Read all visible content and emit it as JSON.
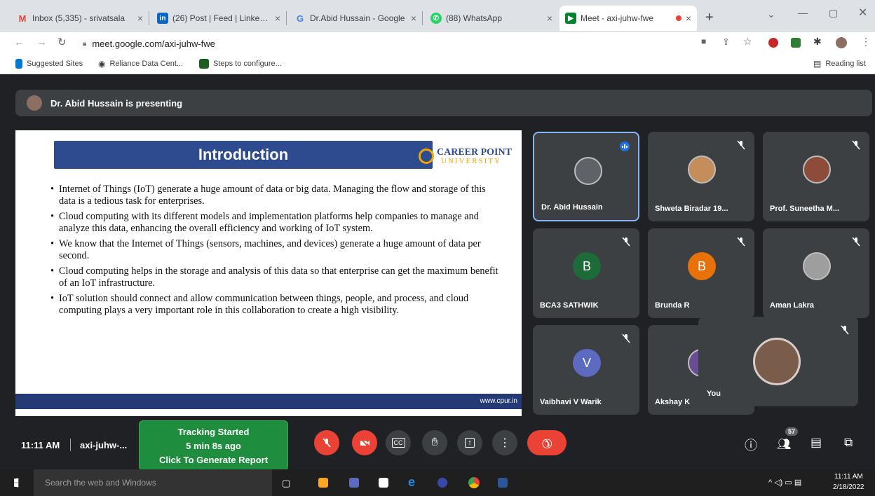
{
  "tabs": [
    {
      "title": "Inbox (5,335) - srivatsala",
      "icon": "gmail-icon",
      "color": "#ea4335"
    },
    {
      "title": "(26) Post | Feed | LinkedIn",
      "icon": "linkedin-icon",
      "color": "#0a66c2"
    },
    {
      "title": "Dr.Abid Hussain - Google",
      "icon": "google-icon",
      "color": "#4285f4"
    },
    {
      "title": "(88) WhatsApp",
      "icon": "whatsapp-icon",
      "color": "#25d366"
    },
    {
      "title": "Meet - axi-juhw-fwe",
      "icon": "meet-icon",
      "color": "#00832d"
    }
  ],
  "browser": {
    "url": "meet.google.com/axi-juhw-fwe",
    "reading_list": "Reading list"
  },
  "bookmarks": [
    "Suggested Sites",
    "Reliance Data Cent...",
    "Steps to configure..."
  ],
  "meet": {
    "presenting": "Dr. Abid Hussain is presenting",
    "time": "11:11 AM",
    "meeting_code": "axi-juhw-...",
    "participant_count": "57",
    "tracking": {
      "line1": "Tracking Started",
      "line2": "5 min 8s ago",
      "line3": "Click To Generate Report"
    }
  },
  "slide": {
    "title": "Introduction",
    "logo_line1": "CAREER POINT",
    "logo_line2": "UNIVERSITY",
    "bullets": [
      "Internet of Things (IoT) generate a huge amount of data or big data. Managing the flow and storage of this data is a tedious task for enterprises.",
      "Cloud computing with its different models and implementation platforms help companies to manage and analyze this data, enhancing the overall efficiency and working of IoT system.",
      "We know that the Internet of Things (sensors, machines, and devices) generate a huge amount of data per second.",
      "Cloud computing helps in the storage and analysis of this data so that enterprise can get the maximum benefit of an IoT infrastructure.",
      "IoT solution should connect and allow communication between things, people, and process, and cloud computing plays a very important role in this collaboration to create a high visibility."
    ],
    "footer": "www.cpur.in"
  },
  "participants": [
    {
      "name": "Dr. Abid Hussain",
      "initial": "",
      "color": "#5f6368",
      "photo": true,
      "speaking": true
    },
    {
      "name": "Shweta Biradar 19...",
      "initial": "",
      "color": "#c58c5c",
      "photo": true
    },
    {
      "name": "Prof. Suneetha M...",
      "initial": "",
      "color": "#8d4b3a",
      "photo": true
    },
    {
      "name": "BCA3 SATHWIK",
      "initial": "B",
      "color": "#1e6b3a"
    },
    {
      "name": "Brunda R",
      "initial": "B",
      "color": "#e8710a"
    },
    {
      "name": "Aman Lakra",
      "initial": "",
      "color": "#9e9e9e",
      "photo": true
    },
    {
      "name": "Vaibhavi V Warik",
      "initial": "V",
      "color": "#5c6bc0"
    },
    {
      "name": "Akshay K",
      "initial": "",
      "color": "#6a4c93",
      "photo": true
    }
  ],
  "self_view": {
    "label": "You"
  },
  "taskbar": {
    "search": "Search the web and Windows",
    "time": "11:11 AM",
    "date": "2/18/2022"
  }
}
